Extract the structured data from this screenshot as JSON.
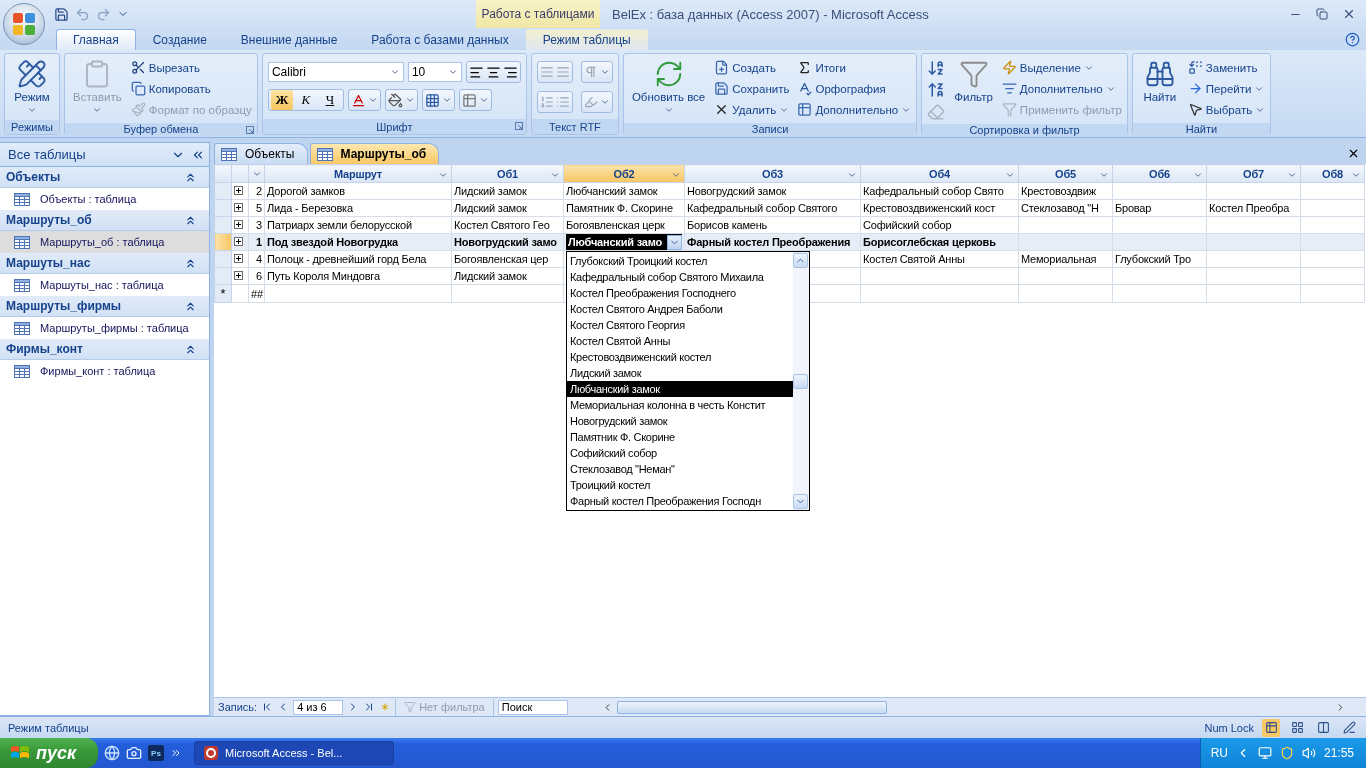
{
  "title_bar": {
    "context": "Работа с таблицами",
    "title": "BelEx : база данных (Access 2007) - Microsoft Access"
  },
  "ribbon_tabs": [
    {
      "label": "Главная",
      "kind": "normal",
      "selected": true
    },
    {
      "label": "Создание",
      "kind": "normal",
      "selected": false
    },
    {
      "label": "Внешние данные",
      "kind": "normal",
      "selected": false
    },
    {
      "label": "Работа с базами данных",
      "kind": "normal",
      "selected": false
    },
    {
      "label": "Режим таблицы",
      "kind": "context",
      "selected": false
    }
  ],
  "ribbon_groups": [
    {
      "label": "Режимы",
      "launcher": false,
      "items": [
        {
          "kind": "large",
          "label": "Режим",
          "menu": true,
          "disabled": false
        }
      ]
    },
    {
      "label": "Буфер обмена",
      "launcher": true,
      "items": [
        {
          "kind": "large",
          "label": "Вставить",
          "menu": true,
          "disabled": true
        },
        {
          "kind": "small",
          "label": "Вырезать",
          "menu": false,
          "disabled": false
        },
        {
          "kind": "small",
          "label": "Копировать",
          "menu": false,
          "disabled": false
        },
        {
          "kind": "small",
          "label": "Формат по образцу",
          "menu": false,
          "disabled": true
        }
      ]
    },
    {
      "label": "Шрифт",
      "launcher": true,
      "items": [
        {
          "kind": "font",
          "font": "Calibri",
          "size": "10",
          "formats": [
            {
              "kind": "bold",
              "label": "Ж",
              "selected": true
            },
            {
              "kind": "italic",
              "label": "К",
              "selected": false
            },
            {
              "kind": "underline",
              "label": "Ч",
              "selected": false
            }
          ]
        }
      ]
    },
    {
      "label": "Текст RTF",
      "launcher": false,
      "items": [
        {
          "kind": "rtf"
        }
      ]
    },
    {
      "label": "Записи",
      "launcher": false,
      "items": [
        {
          "kind": "large",
          "label": "Обновить все",
          "menu": true,
          "disabled": false
        },
        {
          "kind": "small",
          "label": "Создать",
          "menu": false,
          "disabled": false
        },
        {
          "kind": "small",
          "label": "Сохранить",
          "menu": false,
          "disabled": false
        },
        {
          "kind": "small",
          "label": "Удалить",
          "menu": true,
          "disabled": false
        },
        {
          "kind": "small",
          "label": "Итоги",
          "menu": false,
          "disabled": false
        },
        {
          "kind": "small",
          "label": "Орфография",
          "menu": false,
          "disabled": false
        },
        {
          "kind": "small",
          "label": "Дополнительно",
          "menu": true,
          "disabled": false
        }
      ]
    },
    {
      "label": "Сортировка и фильтр",
      "launcher": false,
      "items": [
        {
          "kind": "sort"
        },
        {
          "kind": "large",
          "label": "Фильтр",
          "menu": false,
          "disabled": false
        },
        {
          "kind": "small",
          "label": "Выделение",
          "menu": true,
          "disabled": false
        },
        {
          "kind": "small",
          "label": "Дополнительно",
          "menu": true,
          "disabled": false
        },
        {
          "kind": "small",
          "label": "Применить фильтр",
          "menu": false,
          "disabled": true
        }
      ]
    },
    {
      "label": "Найти",
      "launcher": false,
      "items": [
        {
          "kind": "large",
          "label": "Найти",
          "menu": false,
          "disabled": false
        },
        {
          "kind": "small",
          "label": "Заменить",
          "menu": false,
          "disabled": false
        },
        {
          "kind": "small",
          "label": "Перейти",
          "menu": true,
          "disabled": false
        },
        {
          "kind": "small",
          "label": "Выбрать",
          "menu": true,
          "disabled": false
        }
      ]
    }
  ],
  "nav": {
    "header": "Все таблицы",
    "groups": [
      {
        "label": "Объекты",
        "items": [
          {
            "label": "Объекты : таблица",
            "selected": false
          }
        ]
      },
      {
        "label": "Маршруты_об",
        "items": [
          {
            "label": "Маршруты_об : таблица",
            "selected": true
          }
        ]
      },
      {
        "label": "Маршуты_нас",
        "items": [
          {
            "label": "Маршуты_нас : таблица",
            "selected": false
          }
        ]
      },
      {
        "label": "Маршруты_фирмы",
        "items": [
          {
            "label": "Маршруты_фирмы : таблица",
            "selected": false
          }
        ]
      },
      {
        "label": "Фирмы_конт",
        "items": [
          {
            "label": "Фирмы_конт : таблица",
            "selected": false
          }
        ]
      }
    ]
  },
  "doc_tabs": [
    {
      "label": "Объекты",
      "selected": false
    },
    {
      "label": "Маршруты_об",
      "selected": true
    }
  ],
  "table": {
    "columns": [
      {
        "label": "Маршрут",
        "selected": false
      },
      {
        "label": "Об1",
        "selected": false
      },
      {
        "label": "Об2",
        "selected": true
      },
      {
        "label": "Об3",
        "selected": false
      },
      {
        "label": "Об4",
        "selected": false
      },
      {
        "label": "Об5",
        "selected": false
      },
      {
        "label": "Об6",
        "selected": false
      },
      {
        "label": "Об7",
        "selected": false
      },
      {
        "label": "Об8",
        "selected": false
      }
    ],
    "rows": [
      {
        "id": "2",
        "current": false,
        "cells": [
          "Дорогой замков",
          "Лидский замок",
          "Любчанский замок",
          "Новогрудский замок",
          "Кафедральный собор Свято",
          "Крестовоздвиж",
          null,
          null,
          null
        ]
      },
      {
        "id": "5",
        "current": false,
        "cells": [
          "Лида - Березовка",
          "Лидский замок",
          "Памятник Ф. Скорине",
          "Кафедральный собор Святого",
          "Крестовоздвиженский кост",
          "Стеклозавод \"Н",
          "Бровар",
          "Костел Преобра",
          null
        ]
      },
      {
        "id": "3",
        "current": false,
        "cells": [
          "Патриарх земли белорусской",
          "Костел Святого Гео",
          "Богоявленская церк",
          "Борисов камень",
          "Софийский собор",
          null,
          null,
          null,
          null
        ]
      },
      {
        "id": "1",
        "current": true,
        "cells": [
          "Под звездой Новогрудка",
          "Новогрудский замо",
          {
            "kind": "combo",
            "text": "Любчанский замо"
          },
          "Фарный костел Преображения",
          "Борисоглебская церковь",
          null,
          null,
          null,
          null
        ]
      },
      {
        "id": "4",
        "current": false,
        "cells": [
          "Полоцк - древнейший горд Бела",
          "Богоявленская цер",
          null,
          null,
          "Костел Святой Анны",
          "Мемориальная",
          "Глубокский Тро",
          null,
          null
        ]
      },
      {
        "id": "6",
        "current": false,
        "cells": [
          "Путь Короля Миндовга",
          "Лидский замок",
          null,
          null,
          null,
          null,
          null,
          null,
          null
        ]
      }
    ],
    "new_row": {
      "marker": "*",
      "id": "##"
    },
    "dropdown": {
      "items": [
        {
          "label": "Глубокский Троицкий костел",
          "selected": false
        },
        {
          "label": "Кафедральный собор Святого Михаила",
          "selected": false
        },
        {
          "label": "Костел Преображения Господнего",
          "selected": false
        },
        {
          "label": "Костел Святого Андрея Баболи",
          "selected": false
        },
        {
          "label": "Костел Святого Георгия",
          "selected": false
        },
        {
          "label": "Костел Святой Анны",
          "selected": false
        },
        {
          "label": "Крестовоздвиженский костел",
          "selected": false
        },
        {
          "label": "Лидский замок",
          "selected": false
        },
        {
          "label": "Любчанский замок",
          "selected": true
        },
        {
          "label": "Мемориальная колонна в честь Констит",
          "selected": false
        },
        {
          "label": "Новогрудский замок",
          "selected": false
        },
        {
          "label": "Памятник Ф. Скорине",
          "selected": false
        },
        {
          "label": "Софийский собор",
          "selected": false
        },
        {
          "label": "Стеклозавод \"Неман\"",
          "selected": false
        },
        {
          "label": "Троицкий костел",
          "selected": false
        },
        {
          "label": "Фарный костел Преображения Господн",
          "selected": false
        }
      ]
    }
  },
  "record_nav": {
    "label": "Запись:",
    "position": "4 из 6",
    "filter": "Нет фильтра",
    "filter_active": false,
    "search_placeholder": "Поиск"
  },
  "status_bar": {
    "mode": "Режим таблицы",
    "indicator": "Num Lock"
  },
  "taskbar": {
    "start": "пуск",
    "quick_launch": [
      {
        "kind": "globe"
      },
      {
        "kind": "camera"
      },
      {
        "kind": "app",
        "label": "Ps"
      }
    ],
    "tasks": [
      {
        "label": "Microsoft Access - Bel...",
        "selected": true
      }
    ],
    "language": "RU",
    "clock": "21:55"
  }
}
